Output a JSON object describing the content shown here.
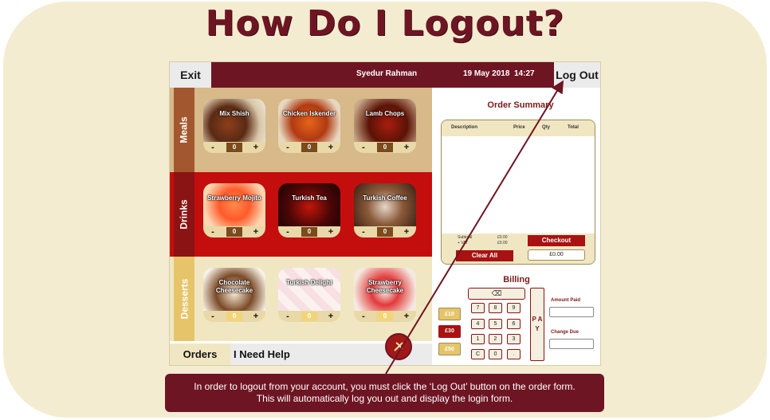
{
  "headline": "How Do I Logout?",
  "topbar": {
    "exit_label": "Exit",
    "user_name": "Syedur Rahman",
    "date": "19 May 2018",
    "time": "14:27",
    "logout_label": "Log Out"
  },
  "categories": {
    "meals": {
      "label": "Meals",
      "items": [
        {
          "name": "Mix Shish",
          "qty": "0",
          "minus": "-",
          "plus": "+"
        },
        {
          "name": "Chicken Iskender",
          "qty": "0",
          "minus": "-",
          "plus": "+"
        },
        {
          "name": "Lamb Chops",
          "qty": "0",
          "minus": "-",
          "plus": "+"
        }
      ]
    },
    "drinks": {
      "label": "Drinks",
      "items": [
        {
          "name": "Strawberry Mojito",
          "qty": "0",
          "minus": "-",
          "plus": "+"
        },
        {
          "name": "Turkish Tea",
          "qty": "0",
          "minus": "-",
          "plus": "+"
        },
        {
          "name": "Turkish Coffee",
          "qty": "0",
          "minus": "-",
          "plus": "+"
        }
      ]
    },
    "desserts": {
      "label": "Desserts",
      "items": [
        {
          "name": "Chocolate Cheesecake",
          "qty": "0",
          "minus": "-",
          "plus": "+"
        },
        {
          "name": "Turkish Delight",
          "qty": "0",
          "minus": "-",
          "plus": "+"
        },
        {
          "name": "Strawberry Cheesecake",
          "qty": "0",
          "minus": "-",
          "plus": "+"
        }
      ]
    }
  },
  "bottom_nav": {
    "orders_label": "Orders",
    "help_label": "I Need Help"
  },
  "order_summary": {
    "title": "Order Summary",
    "columns": [
      "Description",
      "Price",
      "Qty",
      "Total"
    ],
    "subtotal_label": "Subtotal",
    "vat_label": "+ VAT",
    "subtotal_value": "£0.00",
    "vat_value": "£0.00",
    "clear_label": "Clear All",
    "checkout_label": "Checkout",
    "total_value": "£0.00"
  },
  "billing": {
    "title": "Billing",
    "backspace_symbol": "⌫",
    "keys": [
      "7",
      "8",
      "9",
      "4",
      "5",
      "6",
      "1",
      "2",
      "3",
      "C",
      "0",
      "."
    ],
    "pay_label": "P A Y",
    "notes": [
      "£10",
      "£30",
      "£50"
    ],
    "amount_paid_label": "Amount Paid",
    "change_due_label": "Change Due"
  },
  "caption": {
    "line1": "In order to logout from your account, you must click the ‘Log Out’ button on the order form.",
    "line2": "This will automatically log you out and display the login form."
  },
  "colors": {
    "brand_maroon": "#6e1523",
    "card_cream": "#f4ecd0",
    "drinks_red": "#c40e0e",
    "meals_tan": "#d7b98a"
  },
  "icons": {
    "backspace": "backspace-icon",
    "logo": "restaurant-logo-icon"
  }
}
